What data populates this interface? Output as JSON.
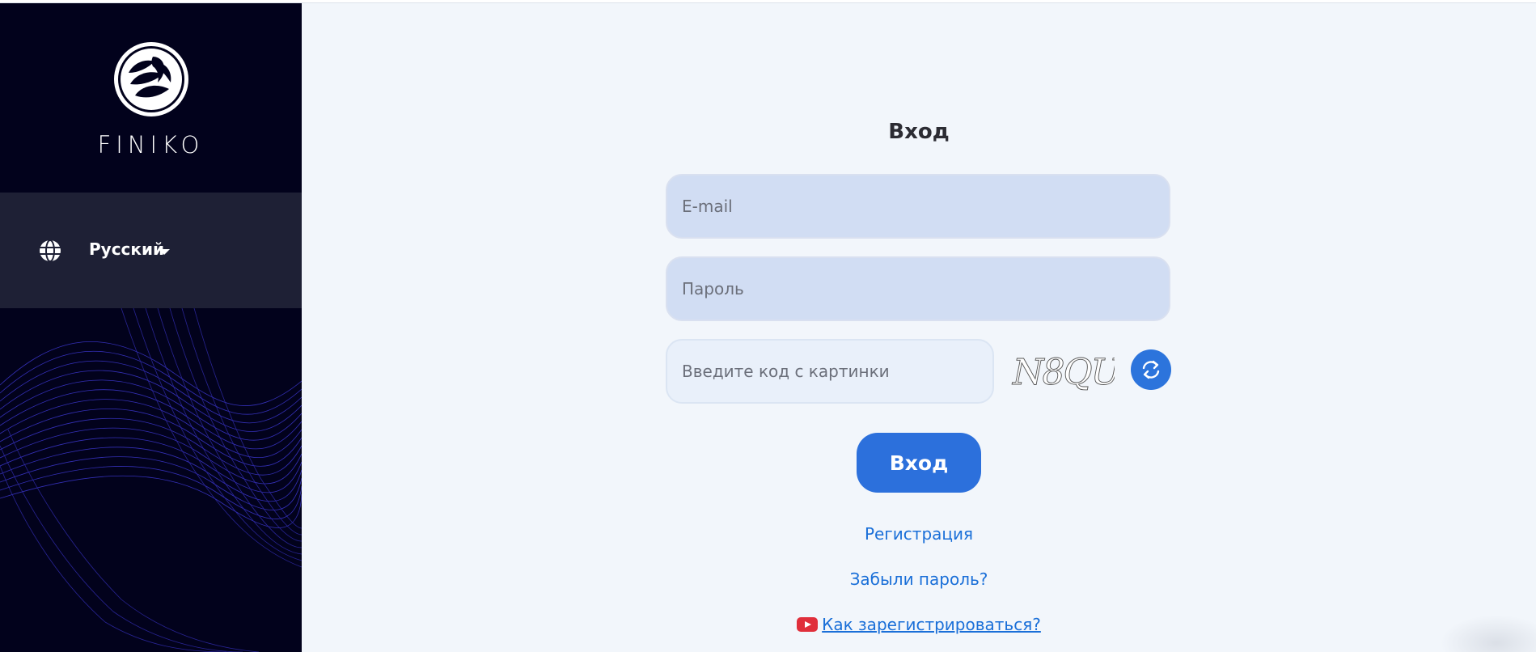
{
  "sidebar": {
    "logo_text": "FINIKO",
    "language": {
      "label": "Русский",
      "icon": "globe-icon"
    }
  },
  "form": {
    "title": "Вход",
    "email_placeholder": "E-mail",
    "password_placeholder": "Пароль",
    "captcha_placeholder": "Введите код с картинки",
    "captcha_text": "N8QU",
    "refresh_icon": "refresh-icon",
    "submit_label": "Вход"
  },
  "links": {
    "register": "Регистрация",
    "forgot": "Забыли пароль?",
    "howto": "Как зарегистрироваться?",
    "howto_icon": "youtube-icon"
  },
  "colors": {
    "sidebar_bg": "#02021c",
    "lang_bg": "#1e2035",
    "accent": "#2c70dc",
    "link": "#1a6fd8",
    "page_bg": "#f2f6fb"
  }
}
